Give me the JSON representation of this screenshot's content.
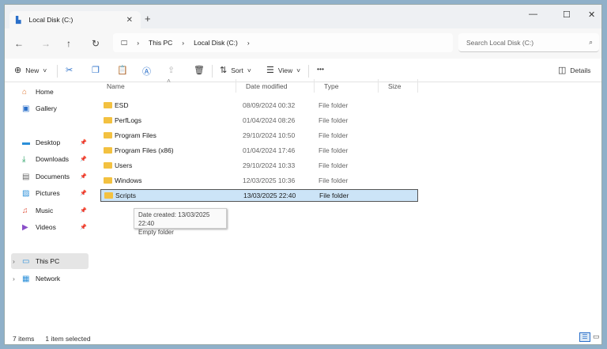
{
  "tab": {
    "title": "Local Disk (C:)"
  },
  "breadcrumb": [
    "This PC",
    "Local Disk (C:)"
  ],
  "search": {
    "placeholder": "Search Local Disk (C:)"
  },
  "toolbar": {
    "new": "New",
    "sort": "Sort",
    "view": "View",
    "more": "•••",
    "details": "Details"
  },
  "sidebar": {
    "items": [
      {
        "label": "Home"
      },
      {
        "label": "Gallery"
      },
      {
        "label": "Desktop"
      },
      {
        "label": "Downloads"
      },
      {
        "label": "Documents"
      },
      {
        "label": "Pictures"
      },
      {
        "label": "Music"
      },
      {
        "label": "Videos"
      },
      {
        "label": "This PC"
      },
      {
        "label": "Network"
      }
    ]
  },
  "columns": [
    "Name",
    "Date modified",
    "Type",
    "Size"
  ],
  "files": [
    {
      "name": "ESD",
      "date": "08/09/2024 00:32",
      "type": "File folder"
    },
    {
      "name": "PerfLogs",
      "date": "01/04/2024 08:26",
      "type": "File folder"
    },
    {
      "name": "Program Files",
      "date": "29/10/2024 10:50",
      "type": "File folder"
    },
    {
      "name": "Program Files (x86)",
      "date": "01/04/2024 17:46",
      "type": "File folder"
    },
    {
      "name": "Users",
      "date": "29/10/2024 10:33",
      "type": "File folder"
    },
    {
      "name": "Windows",
      "date": "12/03/2025 10:36",
      "type": "File folder"
    },
    {
      "name": "Scripts",
      "date": "13/03/2025 22:40",
      "type": "File folder"
    }
  ],
  "tooltip": {
    "line1": "Date created: 13/03/2025 22:40",
    "line2": "Empty folder"
  },
  "status": {
    "count": "7 items",
    "selected": "1 item selected"
  }
}
